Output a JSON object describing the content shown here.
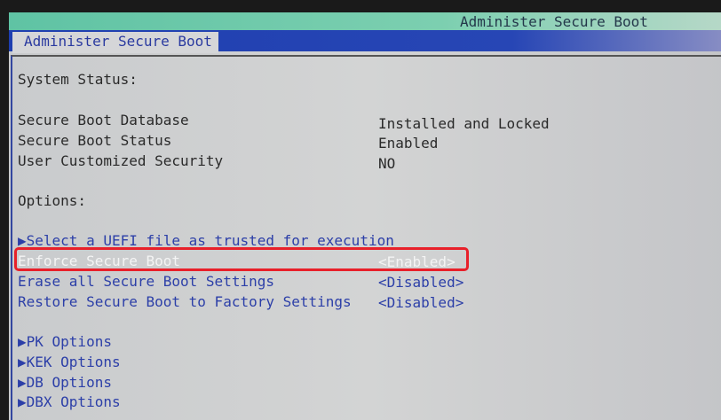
{
  "header": {
    "title": "Administer Secure Boot",
    "tab": "Administer Secure Boot"
  },
  "system_status": {
    "heading": "System Status:",
    "items": [
      {
        "label": "Secure Boot Database",
        "value": "Installed and Locked"
      },
      {
        "label": "Secure Boot Status",
        "value": "Enabled"
      },
      {
        "label": "User Customized Security",
        "value": "NO"
      }
    ]
  },
  "options": {
    "heading": "Options:",
    "items": [
      {
        "label": "▶Select a UEFI file as trusted for execution",
        "value": ""
      },
      {
        "label": "Enforce Secure Boot",
        "value": "<Enabled>",
        "selected": true
      },
      {
        "label": "Erase all Secure Boot Settings",
        "value": "<Disabled>"
      },
      {
        "label": "Restore Secure Boot to Factory Settings",
        "value": "<Disabled>"
      }
    ]
  },
  "submenus": [
    "▶PK Options",
    "▶KEK Options",
    "▶DB Options",
    "▶DBX Options"
  ],
  "colors": {
    "highlight": "#e8202a",
    "tab_bar": "#2746b5",
    "top_bar": "#6cc9a9"
  }
}
